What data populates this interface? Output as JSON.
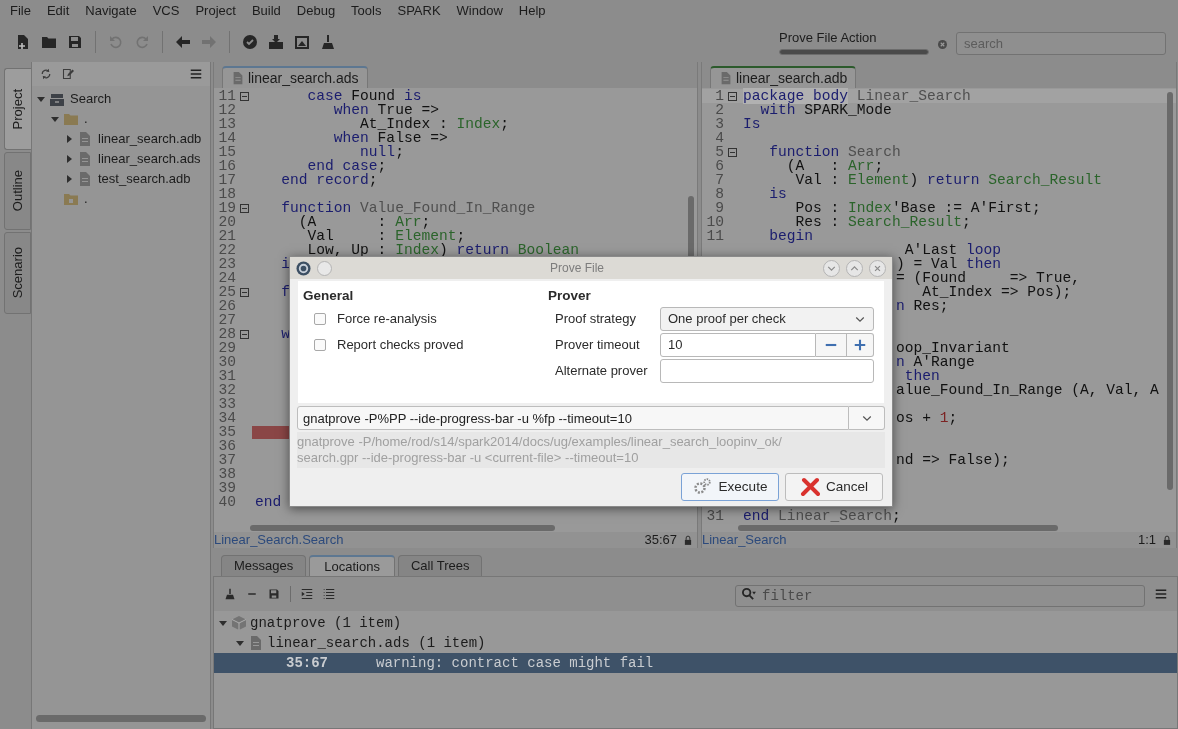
{
  "menu": [
    "File",
    "Edit",
    "Navigate",
    "VCS",
    "Project",
    "Build",
    "Debug",
    "Tools",
    "SPARK",
    "Window",
    "Help"
  ],
  "toolbar": {
    "buttons": [
      {
        "kind": "new-file",
        "disabled": false
      },
      {
        "kind": "open-folder",
        "disabled": false
      },
      {
        "kind": "save",
        "disabled": false
      },
      {
        "kind": "separator"
      },
      {
        "kind": "undo",
        "disabled": true
      },
      {
        "kind": "redo",
        "disabled": true
      },
      {
        "kind": "separator"
      },
      {
        "kind": "back",
        "disabled": false
      },
      {
        "kind": "forward",
        "disabled": true
      },
      {
        "kind": "separator"
      },
      {
        "kind": "check-badge",
        "disabled": false
      },
      {
        "kind": "box",
        "disabled": false
      },
      {
        "kind": "image",
        "disabled": false
      },
      {
        "kind": "broom",
        "disabled": false
      }
    ],
    "task": {
      "label": "Prove File Action",
      "level": 1
    },
    "search": {
      "placeholder": "search"
    }
  },
  "side_tabs": [
    {
      "label": "Project",
      "selected": true
    },
    {
      "label": "Outline",
      "selected": false
    },
    {
      "label": "Scenario",
      "selected": false
    }
  ],
  "project_tree": [
    {
      "label": "Search",
      "kind": "project",
      "expanded": true,
      "children": [
        {
          "label": ".",
          "kind": "folder",
          "expanded": true,
          "children": [
            {
              "label": "linear_search.adb",
              "kind": "file",
              "expanded": false
            },
            {
              "label": "linear_search.ads",
              "kind": "file",
              "expanded": false
            },
            {
              "label": "test_search.adb",
              "kind": "file",
              "expanded": false
            }
          ]
        },
        {
          "label": ".",
          "kind": "object-folder"
        }
      ]
    }
  ],
  "editors": [
    {
      "tab": "linear_search.ads",
      "selected": false,
      "lines": [
        {
          "number": "11",
          "kind": "full",
          "fold": true,
          "tokens": [
            {
              "text": "      case",
              "kind": "keyword"
            },
            {
              "text": " Found ",
              "kind": "plain"
            },
            {
              "text": "is",
              "kind": "keyword"
            }
          ]
        },
        {
          "number": "12",
          "kind": "full",
          "tokens": [
            {
              "text": "         when",
              "kind": "keyword"
            },
            {
              "text": " True =>",
              "kind": "plain"
            }
          ]
        },
        {
          "number": "13",
          "kind": "full",
          "tokens": [
            {
              "text": "            At_Index : ",
              "kind": "plain"
            },
            {
              "text": "Index",
              "kind": "type"
            },
            {
              "text": ";",
              "kind": "plain"
            }
          ]
        },
        {
          "number": "14",
          "kind": "full",
          "tokens": [
            {
              "text": "         when",
              "kind": "keyword"
            },
            {
              "text": " False =>",
              "kind": "plain"
            }
          ]
        },
        {
          "number": "15",
          "kind": "full",
          "tokens": [
            {
              "text": "            null",
              "kind": "keyword"
            },
            {
              "text": ";",
              "kind": "plain"
            }
          ]
        },
        {
          "number": "16",
          "kind": "full",
          "tokens": [
            {
              "text": "      end case",
              "kind": "keyword"
            },
            {
              "text": ";",
              "kind": "plain"
            }
          ]
        },
        {
          "number": "17",
          "kind": "full",
          "tokens": [
            {
              "text": "   end record",
              "kind": "keyword"
            },
            {
              "text": ";",
              "kind": "plain"
            }
          ]
        },
        {
          "number": "18",
          "kind": "full"
        },
        {
          "number": "19",
          "kind": "full",
          "fold": true,
          "tokens": [
            {
              "text": "   function",
              "kind": "keyword"
            },
            {
              "text": " Value_Found_In_Range",
              "kind": "name"
            }
          ]
        },
        {
          "number": "20",
          "kind": "full",
          "tokens": [
            {
              "text": "     (A       : ",
              "kind": "plain"
            },
            {
              "text": "Arr",
              "kind": "type"
            },
            {
              "text": ";",
              "kind": "plain"
            }
          ]
        },
        {
          "number": "21",
          "kind": "full",
          "tokens": [
            {
              "text": "      Val     : ",
              "kind": "plain"
            },
            {
              "text": "Element",
              "kind": "type"
            },
            {
              "text": ";",
              "kind": "plain"
            }
          ]
        },
        {
          "number": "22",
          "kind": "full",
          "tokens": [
            {
              "text": "      Low, Up : ",
              "kind": "plain"
            },
            {
              "text": "Index",
              "kind": "type"
            },
            {
              "text": ") ",
              "kind": "plain"
            },
            {
              "text": "return",
              "kind": "keyword"
            },
            {
              "text": " Boolean",
              "kind": "type"
            }
          ]
        },
        {
          "number": "23",
          "kind": "head",
          "tokens": [
            {
              "text": "   i",
              "kind": "keyword"
            }
          ]
        },
        {
          "number": "24",
          "kind": "head"
        },
        {
          "number": "25",
          "kind": "head",
          "fold": true,
          "tokens": [
            {
              "text": "   f",
              "kind": "keyword"
            }
          ]
        },
        {
          "number": "26",
          "kind": "head"
        },
        {
          "number": "27",
          "kind": "head"
        },
        {
          "number": "28",
          "kind": "head",
          "fold": true,
          "tokens": [
            {
              "text": "   w",
              "kind": "keyword"
            }
          ]
        },
        {
          "number": "29",
          "kind": "head"
        },
        {
          "number": "30",
          "kind": "head"
        },
        {
          "number": "31",
          "kind": "head"
        },
        {
          "number": "32",
          "kind": "head"
        },
        {
          "number": "33",
          "kind": "head"
        },
        {
          "number": "34",
          "kind": "head"
        },
        {
          "number": "35",
          "kind": "error"
        },
        {
          "number": "36",
          "kind": "head"
        },
        {
          "number": "37",
          "kind": "head"
        },
        {
          "number": "38",
          "kind": "head"
        },
        {
          "number": "39",
          "kind": "head"
        },
        {
          "number": "40",
          "kind": "full",
          "tokens": [
            {
              "text": "end",
              "kind": "keyword"
            }
          ]
        }
      ],
      "status": {
        "location": "Linear_Search.Search",
        "cursor": "35:67"
      }
    },
    {
      "tab": "linear_search.adb",
      "selected": true,
      "lines": [
        {
          "number": "1",
          "kind": "current",
          "fold": true,
          "tokens": [
            {
              "text": "package body",
              "kind": "keyword"
            },
            {
              "text": " Linear_Search",
              "kind": "name"
            }
          ]
        },
        {
          "number": "2",
          "kind": "full",
          "tokens": [
            {
              "text": "  with",
              "kind": "keyword"
            },
            {
              "text": " SPARK_Mode",
              "kind": "plain"
            }
          ]
        },
        {
          "number": "3",
          "kind": "full",
          "tokens": [
            {
              "text": "Is",
              "kind": "keyword"
            }
          ]
        },
        {
          "number": "4",
          "kind": "full"
        },
        {
          "number": "5",
          "kind": "full",
          "fold": true,
          "tokens": [
            {
              "text": "   function",
              "kind": "keyword"
            },
            {
              "text": " Search",
              "kind": "name"
            }
          ]
        },
        {
          "number": "6",
          "kind": "full",
          "tokens": [
            {
              "text": "     (A   : ",
              "kind": "plain"
            },
            {
              "text": "Arr",
              "kind": "type"
            },
            {
              "text": ";",
              "kind": "plain"
            }
          ]
        },
        {
          "number": "7",
          "kind": "full",
          "tokens": [
            {
              "text": "      Val : ",
              "kind": "plain"
            },
            {
              "text": "Element",
              "kind": "type"
            },
            {
              "text": ") ",
              "kind": "plain"
            },
            {
              "text": "return",
              "kind": "keyword"
            },
            {
              "text": " Search_Result",
              "kind": "type"
            }
          ]
        },
        {
          "number": "8",
          "kind": "full",
          "tokens": [
            {
              "text": "   is",
              "kind": "keyword"
            }
          ]
        },
        {
          "number": "9",
          "kind": "full",
          "tokens": [
            {
              "text": "      Pos : ",
              "kind": "plain"
            },
            {
              "text": "Index",
              "kind": "type"
            },
            {
              "text": "'Base := A'First;",
              "kind": "plain"
            }
          ]
        },
        {
          "number": "10",
          "kind": "full",
          "tokens": [
            {
              "text": "      Res : ",
              "kind": "plain"
            },
            {
              "text": "Search_Result",
              "kind": "type"
            },
            {
              "text": ";",
              "kind": "plain"
            }
          ]
        },
        {
          "number": "11",
          "kind": "full",
          "tokens": [
            {
              "text": "   begin",
              "kind": "keyword"
            }
          ]
        },
        {
          "kind": "tail",
          "tokens": [
            {
              "text": " A'Last ",
              "kind": "plain"
            },
            {
              "text": "loop",
              "kind": "keyword"
            }
          ]
        },
        {
          "kind": "tail",
          "tokens": [
            {
              "text": ") = Val ",
              "kind": "plain"
            },
            {
              "text": "then",
              "kind": "keyword"
            }
          ]
        },
        {
          "kind": "tail",
          "tokens": [
            {
              "text": "= (Found     => True,",
              "kind": "plain"
            }
          ]
        },
        {
          "kind": "tail",
          "tokens": [
            {
              "text": "   At_Index => Pos);",
              "kind": "plain"
            }
          ]
        },
        {
          "kind": "tail",
          "tokens": [
            {
              "text": "n",
              "kind": "keyword"
            },
            {
              "text": " Res;",
              "kind": "plain"
            }
          ]
        },
        {
          "kind": "tail"
        },
        {
          "kind": "tail"
        },
        {
          "kind": "tail",
          "tokens": [
            {
              "text": "oop_Invariant",
              "kind": "plain"
            }
          ]
        },
        {
          "kind": "tail",
          "tokens": [
            {
              "text": "n",
              "kind": "keyword"
            },
            {
              "text": " A'Range",
              "kind": "plain"
            }
          ]
        },
        {
          "kind": "tail",
          "tokens": [
            {
              "text": " then",
              "kind": "keyword"
            }
          ]
        },
        {
          "kind": "tail",
          "tokens": [
            {
              "text": "alue_Found_In_Range (A, Val, A",
              "kind": "plain"
            }
          ]
        },
        {
          "kind": "tail"
        },
        {
          "kind": "tail",
          "tokens": [
            {
              "text": "os + ",
              "kind": "plain"
            },
            {
              "text": "1",
              "kind": "number"
            },
            {
              "text": ";",
              "kind": "plain"
            }
          ]
        },
        {
          "kind": "tail"
        },
        {
          "kind": "tail"
        },
        {
          "kind": "tail",
          "tokens": [
            {
              "text": "nd => False);",
              "kind": "plain"
            }
          ]
        },
        {
          "kind": "tail"
        },
        {
          "kind": "tail"
        },
        {
          "kind": "tail"
        },
        {
          "number": "31",
          "kind": "full",
          "tokens": [
            {
              "text": "end",
              "kind": "keyword"
            },
            {
              "text": " Linear_Search",
              "kind": "name"
            },
            {
              "text": ";",
              "kind": "plain"
            }
          ]
        }
      ],
      "status": {
        "location": "Linear_Search",
        "cursor": "1:1"
      }
    }
  ],
  "bottom": {
    "tabs": [
      {
        "label": "Messages",
        "selected": false
      },
      {
        "label": "Locations",
        "selected": true
      },
      {
        "label": "Call Trees",
        "selected": false
      }
    ],
    "filter": {
      "placeholder": "filter"
    },
    "locations": [
      {
        "label": "gnatprove (1 item)",
        "kind": "category",
        "expanded": true,
        "children": [
          {
            "label": "linear_search.ads (1 item)",
            "kind": "file",
            "expanded": true,
            "children": [
              {
                "kind": "message",
                "location": "35:67",
                "message": "warning: contract case might fail",
                "selected": true
              }
            ]
          }
        ]
      }
    ]
  },
  "dialog": {
    "title": "Prove File",
    "general": {
      "heading": "General",
      "options": [
        {
          "label": "Force re-analysis",
          "checked": false
        },
        {
          "label": "Report checks proved",
          "checked": false
        }
      ]
    },
    "prover": {
      "heading": "Prover",
      "proof_strategy": {
        "label": "Proof strategy",
        "value": "One proof per check"
      },
      "prover_timeout": {
        "label": "Prover timeout",
        "value": "10"
      },
      "alternate_prover": {
        "label": "Alternate prover"
      }
    },
    "command": "gnatprove -P%PP --ide-progress-bar -u %fp --timeout=10",
    "preview_lines": [
      "gnatprove -P/home/rod/s14/spark2014/docs/ug/examples/linear_search_loopinv_ok/",
      "search.gpr --ide-progress-bar -u <current-file> --timeout=10"
    ],
    "buttons": [
      {
        "label": "Execute",
        "kind": "execute",
        "focused": true
      },
      {
        "label": "Cancel",
        "kind": "cancel",
        "focused": false
      }
    ]
  }
}
